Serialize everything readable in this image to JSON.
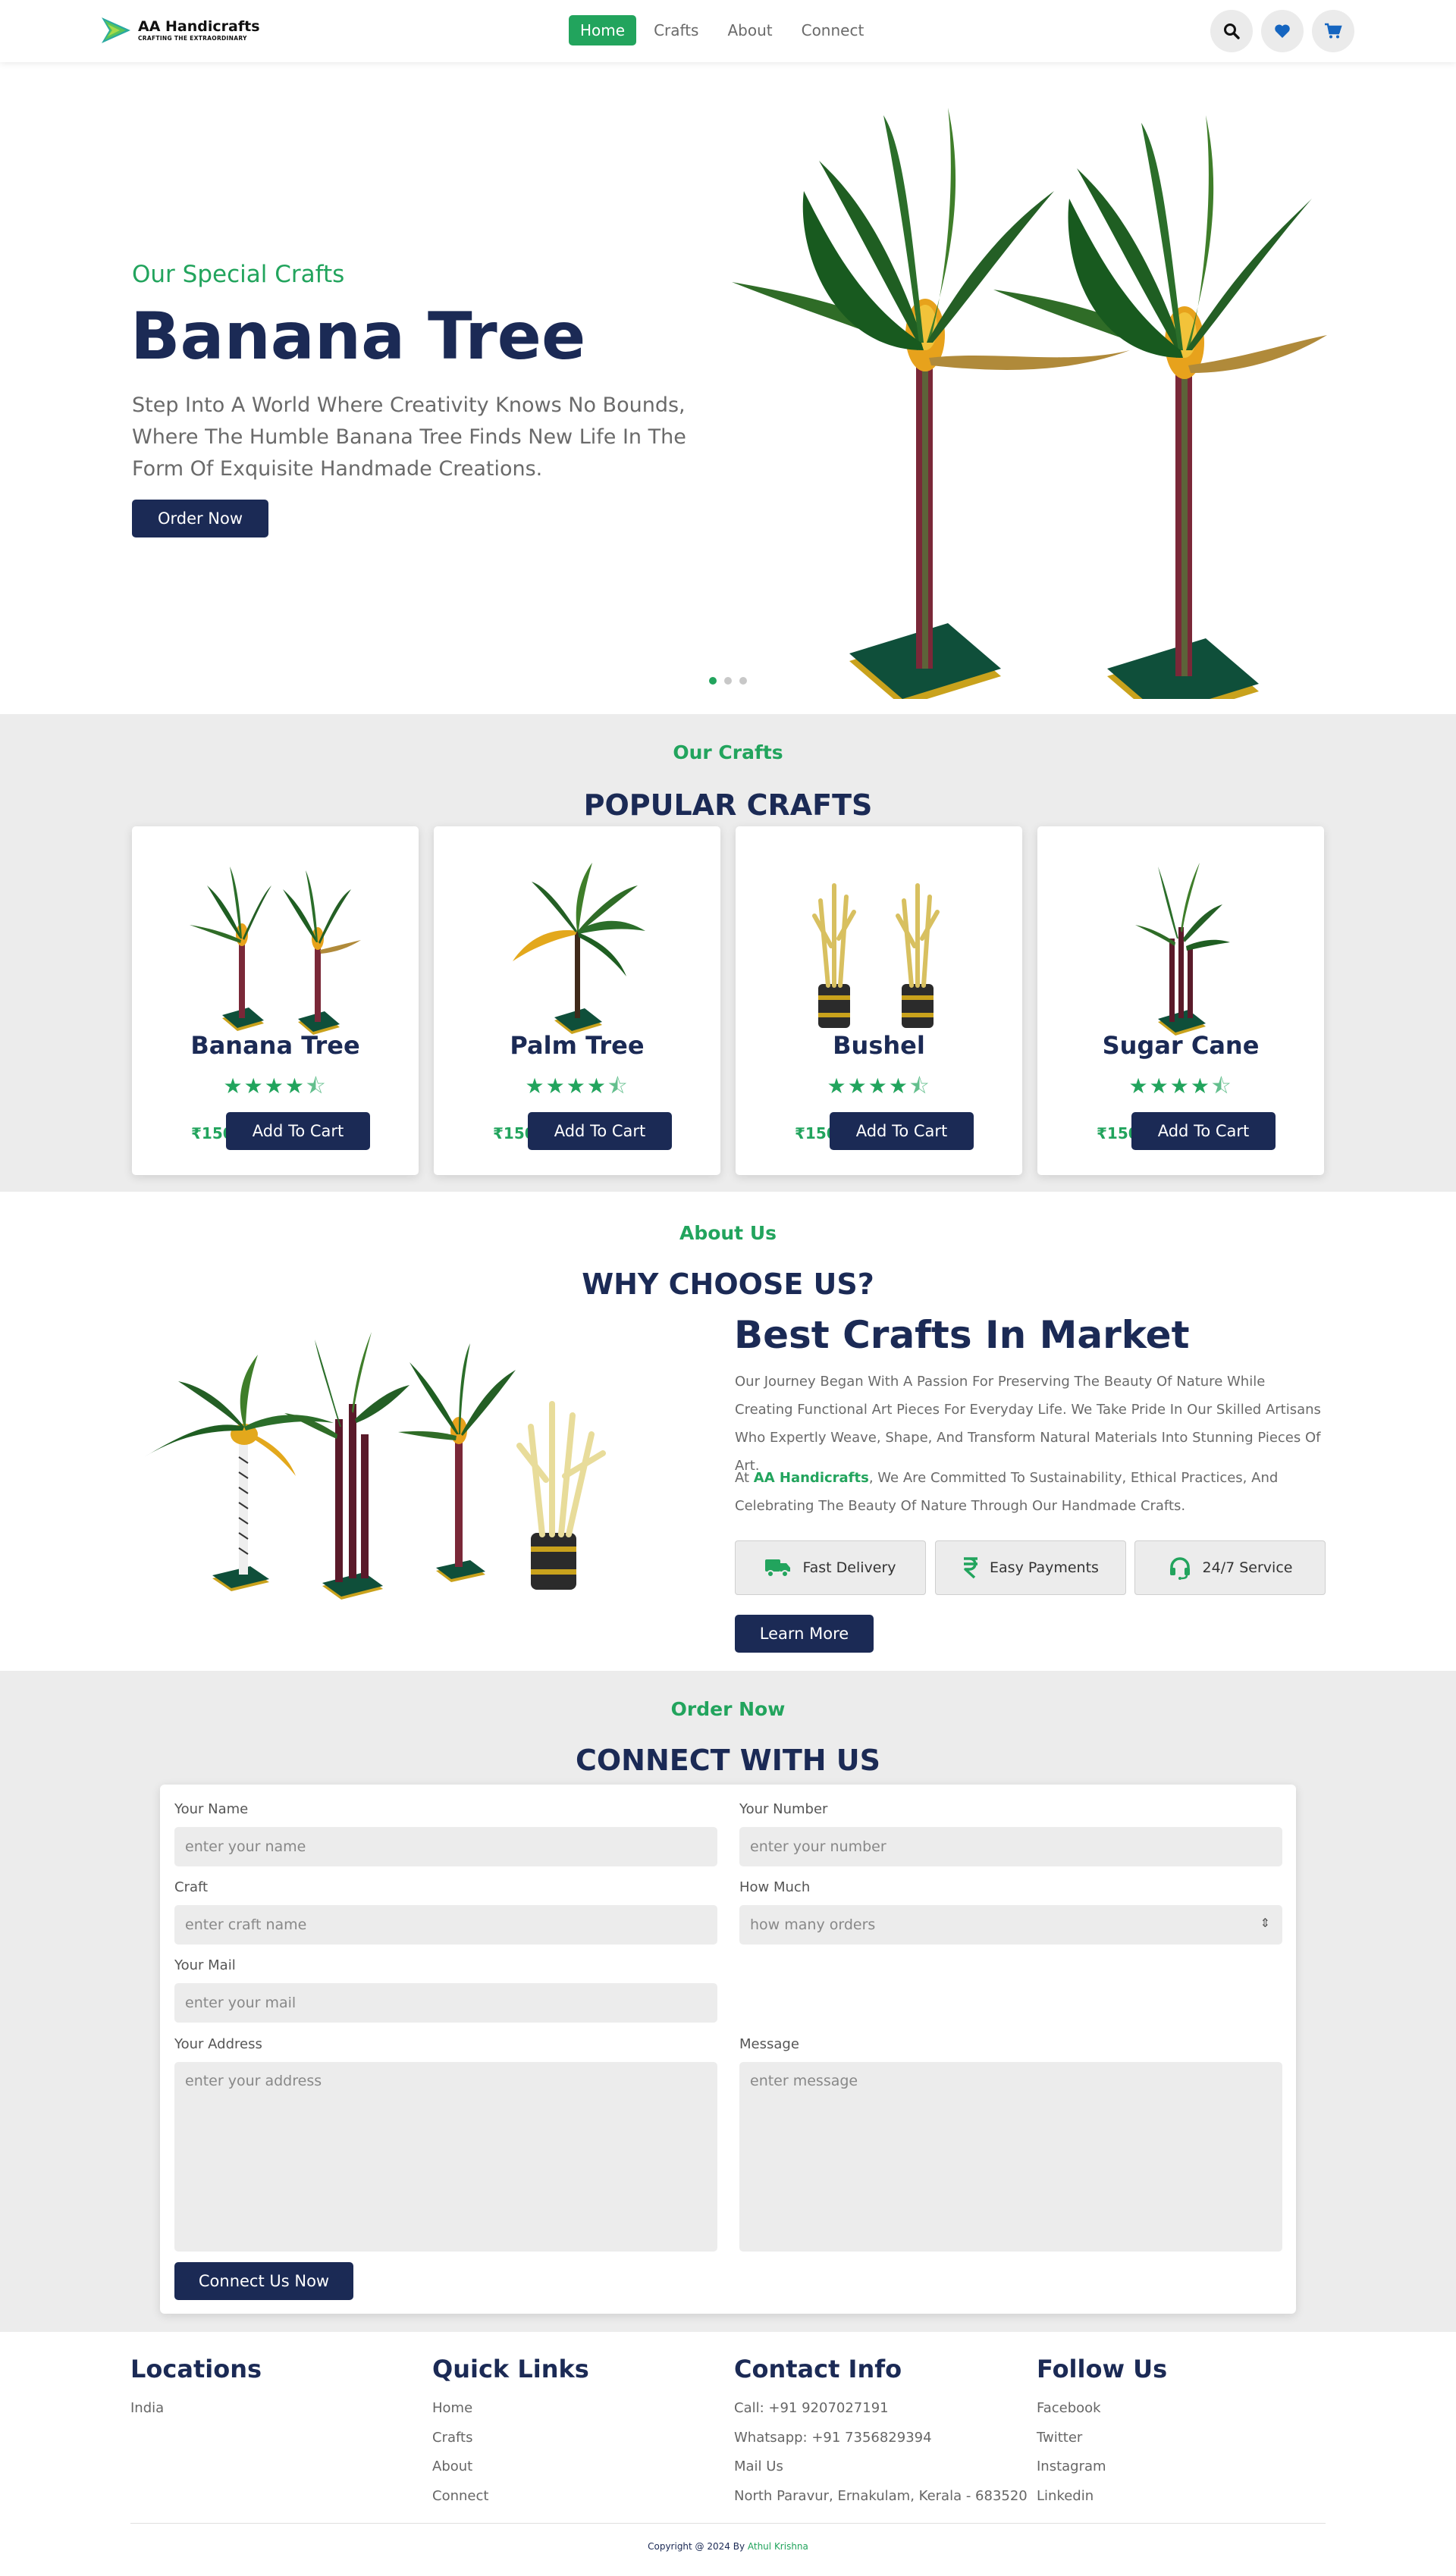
{
  "brand": {
    "name": "AA Handicrafts",
    "tagline": "CRAFTING THE EXTRAORDINARY"
  },
  "nav": {
    "items": [
      {
        "label": "Home"
      },
      {
        "label": "Crafts"
      },
      {
        "label": "About"
      },
      {
        "label": "Connect"
      }
    ],
    "active": "Home"
  },
  "nav_icons": [
    "search-icon",
    "heart-icon",
    "cart-icon"
  ],
  "hero": {
    "subtitle": "Our Special Crafts",
    "title": "Banana Tree",
    "description": "Step Into A World Where Creativity Knows No Bounds, Where The Humble Banana Tree Finds New Life In The Form Of Exquisite Handmade Creations.",
    "button": "Order Now",
    "slide_count": 3,
    "active_slide": 1
  },
  "crafts": {
    "label": "Our Crafts",
    "title": "POPULAR CRAFTS",
    "items": [
      {
        "name": "Banana Tree",
        "rating": 4.5,
        "price": "₹150",
        "button": "Add To Cart"
      },
      {
        "name": "Palm Tree",
        "rating": 4.5,
        "price": "₹150",
        "button": "Add To Cart"
      },
      {
        "name": "Bushel",
        "rating": 4.5,
        "price": "₹150",
        "button": "Add To Cart"
      },
      {
        "name": "Sugar Cane",
        "rating": 4.5,
        "price": "₹150",
        "button": "Add To Cart"
      }
    ]
  },
  "about": {
    "label": "About Us",
    "title": "WHY CHOOSE US?",
    "heading": "Best Crafts In Market",
    "paragraph1": "Our Journey Began With A Passion For Preserving The Beauty Of Nature While Creating Functional Art Pieces For Everyday Life. We Take Pride In Our Skilled Artisans Who Expertly Weave, Shape, And Transform Natural Materials Into Stunning Pieces Of Art.",
    "paragraph2_prefix": "At ",
    "paragraph2_brand": "AA Handicrafts",
    "paragraph2_suffix": ", We Are Committed To Sustainability, Ethical Practices, And Celebrating The Beauty Of Nature Through Our Handmade Crafts.",
    "features": [
      {
        "label": "Fast Delivery",
        "icon": "truck-icon"
      },
      {
        "label": "Easy Payments",
        "icon": "rupee-icon"
      },
      {
        "label": "24/7 Service",
        "icon": "headset-icon"
      }
    ],
    "button": "Learn More"
  },
  "connect": {
    "label": "Order Now",
    "title": "CONNECT WITH US",
    "fields": {
      "name": {
        "label": "Your Name",
        "placeholder": "enter your name"
      },
      "number": {
        "label": "Your Number",
        "placeholder": "enter your number"
      },
      "craft": {
        "label": "Craft",
        "placeholder": "enter craft name"
      },
      "how_much": {
        "label": "How Much",
        "placeholder": "how many orders"
      },
      "mail": {
        "label": "Your Mail",
        "placeholder": "enter your mail"
      },
      "address": {
        "label": "Your Address",
        "placeholder": "enter your address"
      },
      "message": {
        "label": "Message",
        "placeholder": "enter message"
      }
    },
    "button": "Connect Us Now"
  },
  "footer": {
    "locations": {
      "title": "Locations",
      "items": [
        "India"
      ]
    },
    "quick_links": {
      "title": "Quick Links",
      "items": [
        "Home",
        "Crafts",
        "About",
        "Connect"
      ]
    },
    "contact": {
      "title": "Contact Info",
      "items": [
        "Call: +91 9207027191",
        "Whatsapp: +91 7356829394",
        "Mail Us",
        "North Paravur, Ernakulam, Kerala - 683520"
      ]
    },
    "follow": {
      "title": "Follow Us",
      "items": [
        "Facebook",
        "Twitter",
        "Instagram",
        "Linkedin"
      ]
    },
    "copyright_prefix": "Copyright @ 2024 By ",
    "copyright_author": "Athul Krishna"
  },
  "colors": {
    "primary": "#1b2a55",
    "accent": "#22a45d",
    "section_bg": "#ececec",
    "icon_blue": "#1565c0"
  }
}
